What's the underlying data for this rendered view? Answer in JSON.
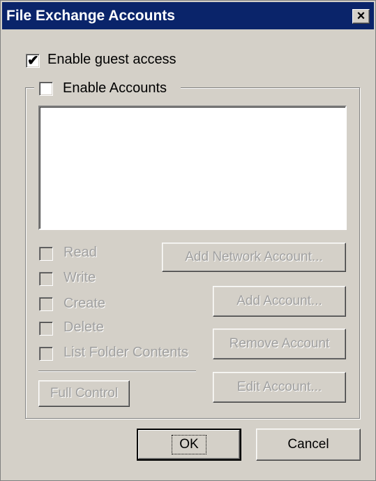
{
  "window": {
    "title": "File Exchange Accounts",
    "close_glyph": "×"
  },
  "guest_access": {
    "label": "Enable guest access",
    "checked": true
  },
  "accounts": {
    "label": "Enable Accounts",
    "checked": false,
    "list_items": []
  },
  "permissions": [
    {
      "label": "Read"
    },
    {
      "label": "Write"
    },
    {
      "label": "Create"
    },
    {
      "label": "Delete"
    },
    {
      "label": "List Folder Contents"
    }
  ],
  "buttons": {
    "full_control": "Full Control",
    "add_network_account": "Add Network Account...",
    "add_account": "Add Account...",
    "remove_account": "Remove Account",
    "edit_account": "Edit Account...",
    "ok": "OK",
    "cancel": "Cancel"
  },
  "icons": {
    "check": "✔"
  }
}
